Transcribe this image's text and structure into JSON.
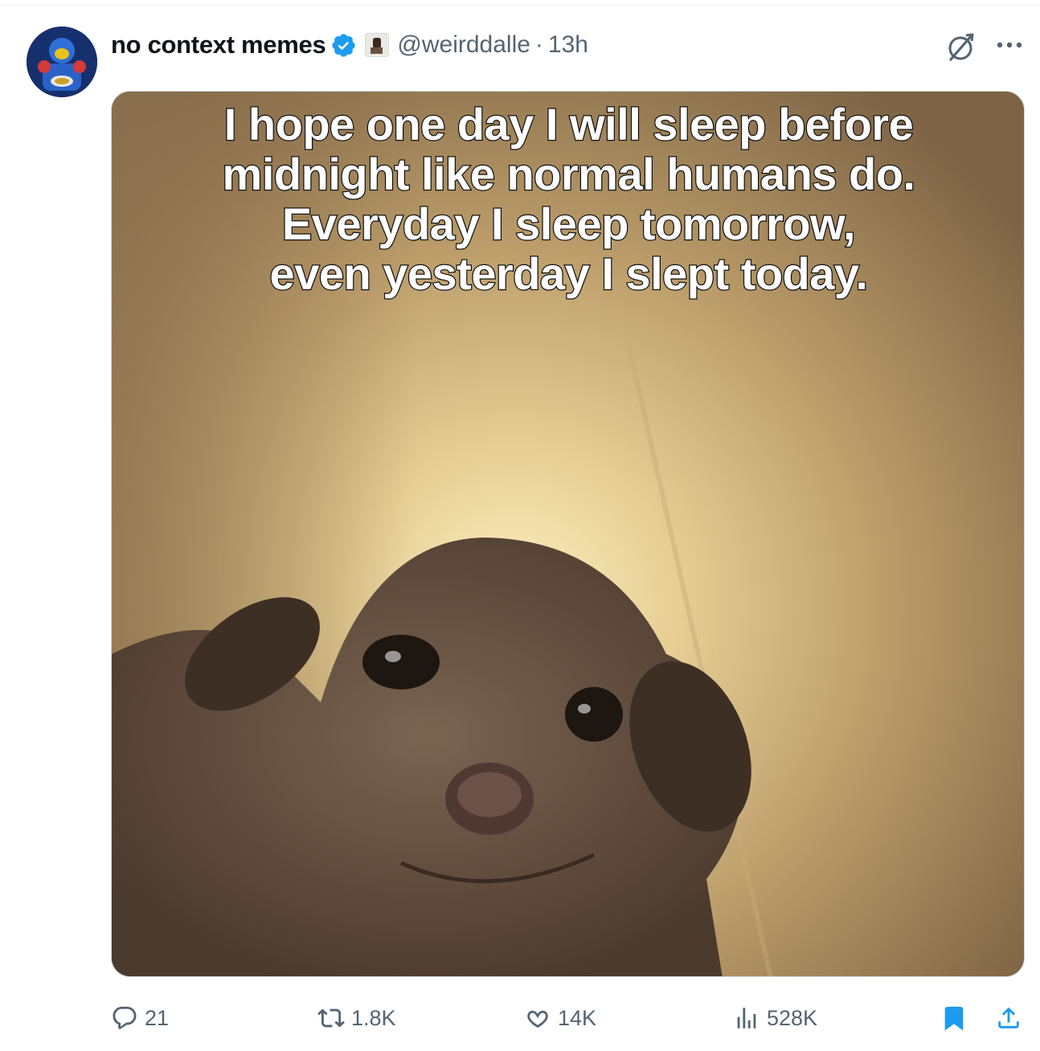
{
  "tweet": {
    "display_name": "no context memes",
    "handle": "@weirddalle",
    "separator": "·",
    "time": "13h",
    "caption_lines": [
      "I hope one day I will sleep before",
      "midnight like normal humans do.",
      "Everyday I sleep tomorrow,",
      "even yesterday I slept today."
    ]
  },
  "actions": {
    "replies": "21",
    "retweets": "1.8K",
    "likes": "14K",
    "views": "528K"
  },
  "icons": {
    "verified": "verified-badge-icon",
    "affiliate": "affiliate-badge-icon",
    "grok": "grok-icon",
    "more": "more-icon",
    "reply": "reply-icon",
    "retweet": "retweet-icon",
    "like": "heart-icon",
    "views": "views-icon",
    "bookmark": "bookmark-icon",
    "share": "share-icon"
  },
  "colors": {
    "verified": "#1d9bf0",
    "secondary_text": "#536471",
    "bookmark_active": "#1d9bf0"
  }
}
